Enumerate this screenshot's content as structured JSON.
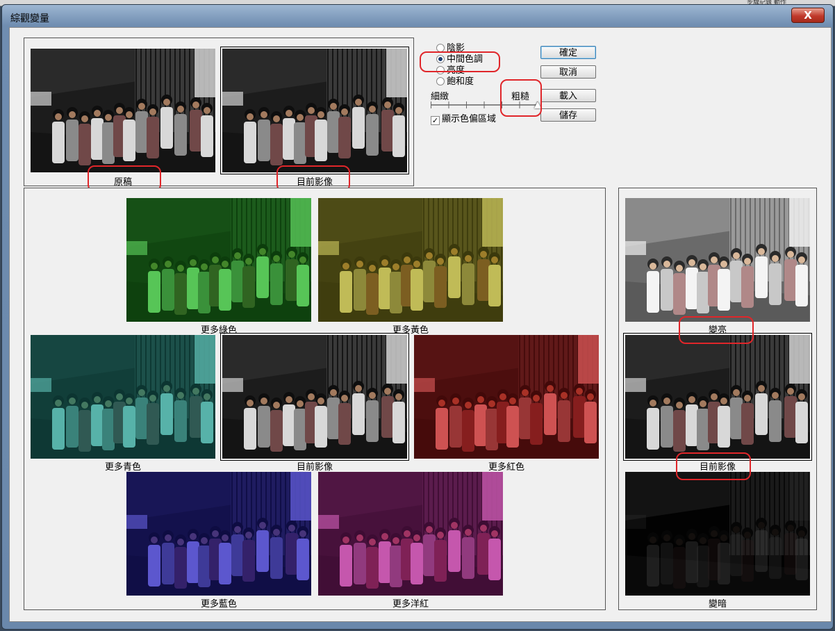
{
  "dialog": {
    "title": "綜觀變量",
    "close_symbol": "X"
  },
  "topbar": {
    "right_text": "步驟記錄   動作"
  },
  "preview": {
    "original_label": "原稿",
    "current_label": "目前影像"
  },
  "options": {
    "radios": [
      {
        "label": "陰影",
        "selected": false
      },
      {
        "label": "中間色調",
        "selected": true
      },
      {
        "label": "亮度",
        "selected": false
      },
      {
        "label": "飽和度",
        "selected": false
      }
    ],
    "fine_label": "細緻",
    "coarse_label": "粗糙",
    "slider_level": 1.0,
    "show_clipping_label": "顯示色偏區域",
    "show_clipping_checked": true,
    "check_mark": "✓"
  },
  "buttons": {
    "ok": "確定",
    "cancel": "取消",
    "load": "載入",
    "save": "儲存"
  },
  "variations": {
    "more_green": "更多綠色",
    "more_yellow": "更多黃色",
    "more_cyan": "更多青色",
    "current": "目前影像",
    "more_red": "更多紅色",
    "more_blue": "更多藍色",
    "more_magenta": "更多洋紅"
  },
  "brightness": {
    "lighter": "變亮",
    "current": "目前影像",
    "darker": "變暗"
  },
  "tints": {
    "original": "#000000",
    "green": "#18d018",
    "yellow": "#c8c018",
    "cyan": "#18b0a0",
    "red": "#e01010",
    "blue": "#2018e0",
    "magenta": "#d018a8",
    "annotation": "#e0262a"
  }
}
